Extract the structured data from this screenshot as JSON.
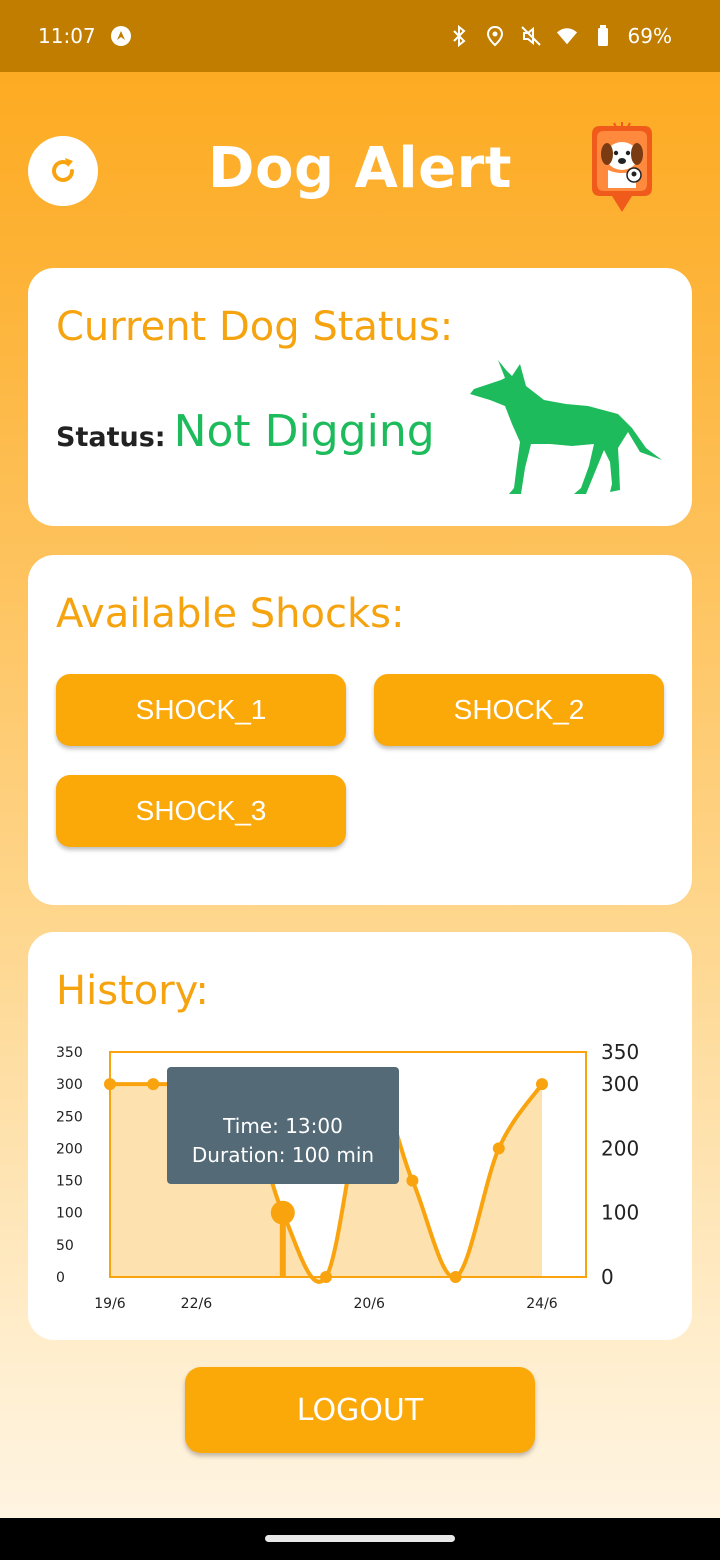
{
  "status_bar": {
    "time": "11:07",
    "battery": "69%",
    "icons": [
      "app-notification-icon",
      "bluetooth-icon",
      "location-icon",
      "mute-icon",
      "wifi-icon",
      "battery-icon"
    ]
  },
  "header": {
    "title": "Dog Alert",
    "refresh_icon": "refresh-icon",
    "logo": "dog-alert-logo"
  },
  "status_card": {
    "title": "Current Dog Status:",
    "label": "Status:",
    "value": "Not Digging",
    "value_color": "#1dbb5c"
  },
  "shocks_card": {
    "title": "Available Shocks:",
    "buttons": [
      "SHOCK_1",
      "SHOCK_2",
      "SHOCK_3"
    ]
  },
  "history_card": {
    "title": "History:",
    "tooltip": {
      "time": "Time: 13:00",
      "duration": "Duration: 100 min"
    }
  },
  "chart_data": {
    "type": "area",
    "x_tick_labels": [
      "19/6",
      "22/6",
      "20/6",
      "24/6"
    ],
    "left_axis": {
      "ticks": [
        "350",
        "300",
        "250",
        "200",
        "150",
        "100",
        "50",
        "0"
      ],
      "range": [
        0,
        350
      ]
    },
    "right_axis": {
      "ticks": [
        "350",
        "300",
        "200",
        "100",
        "0"
      ],
      "range": [
        0,
        350
      ]
    },
    "series": [
      {
        "values": [
          300,
          300,
          300,
          300,
          100,
          0,
          300,
          150,
          0,
          200,
          300
        ]
      }
    ],
    "highlighted_index": 4,
    "grid": false,
    "color": "#f9a30f"
  },
  "logout": {
    "label": "LOGOUT"
  }
}
